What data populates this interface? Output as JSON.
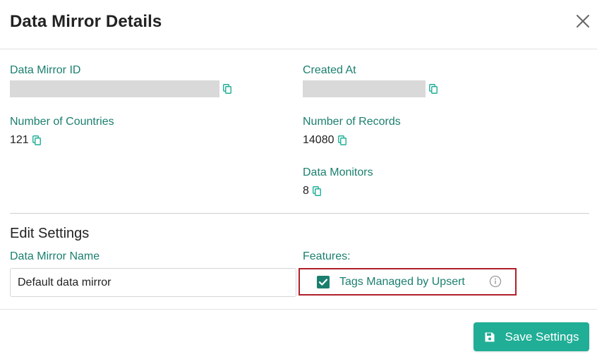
{
  "dialog": {
    "title": "Data Mirror Details"
  },
  "details": {
    "data_mirror_id": {
      "label": "Data Mirror ID",
      "value": ""
    },
    "created_at": {
      "label": "Created At",
      "value": ""
    },
    "number_of_countries": {
      "label": "Number of Countries",
      "value": "121"
    },
    "number_of_records": {
      "label": "Number of Records",
      "value": "14080"
    },
    "data_monitors": {
      "label": "Data Monitors",
      "value": "8"
    }
  },
  "edit_settings": {
    "title": "Edit Settings",
    "name_label": "Data Mirror Name",
    "name_value": "Default data mirror",
    "features_label": "Features:",
    "feature": {
      "label": "Tags Managed by Upsert",
      "checked": true
    }
  },
  "footer": {
    "save_label": "Save Settings"
  },
  "colors": {
    "accent": "#1b7f6f",
    "button": "#20ae96",
    "highlight_border": "#b0202a"
  },
  "icons": {
    "close": "close-icon",
    "copy": "copy-icon",
    "info": "info-icon",
    "save": "save-icon",
    "check": "checkmark-icon"
  }
}
